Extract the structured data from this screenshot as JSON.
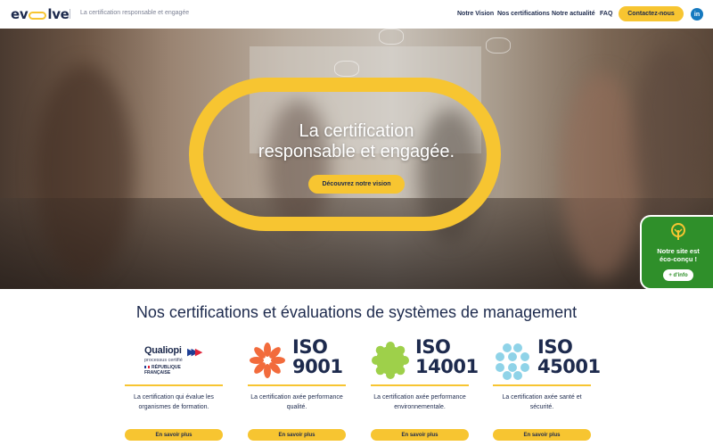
{
  "header": {
    "logo": {
      "pre": "ev",
      "post": "lve"
    },
    "tagline": "La certification responsable et engagée",
    "nav": [
      "Notre Vision",
      "Nos certifications",
      "Notre actualité",
      "FAQ"
    ],
    "contact_label": "Contactez-nous",
    "linkedin_label": "in"
  },
  "hero": {
    "title_line1": "La certification",
    "title_line2": "responsable et engagée.",
    "button_label": "Découvrez notre vision"
  },
  "eco_badge": {
    "line1": "Notre site est",
    "line2": "éco-conçu !",
    "button_label": "+ d'info"
  },
  "section": {
    "title": "Nos certifications et évaluations de systèmes de management",
    "cards": [
      {
        "logo": {
          "name": "Qualiopi",
          "subtitle": "processus certifié",
          "republic": "RÉPUBLIQUE FRANÇAISE"
        },
        "description": "La certification qui évalue les organismes de formation.",
        "button_label": "En savoir plus"
      },
      {
        "logo": {
          "line1": "ISO",
          "line2": "9001"
        },
        "description": "La certification axée performance qualité.",
        "button_label": "En savoir plus"
      },
      {
        "logo": {
          "line1": "ISO",
          "line2": "14001"
        },
        "description": "La certification axée performance environnementale.",
        "button_label": "En savoir plus"
      },
      {
        "logo": {
          "line1": "ISO",
          "line2": "45001"
        },
        "description": "La certification axée santé et sécurité.",
        "button_label": "En savoir plus"
      }
    ]
  },
  "colors": {
    "accent": "#f7c531",
    "navy": "#1d2a4d",
    "iso9001": "#f26b3c",
    "iso14001": "#9ed04a",
    "iso45001": "#8fd3e8",
    "eco_green": "#2f8f2a",
    "linkedin": "#1679bf"
  }
}
